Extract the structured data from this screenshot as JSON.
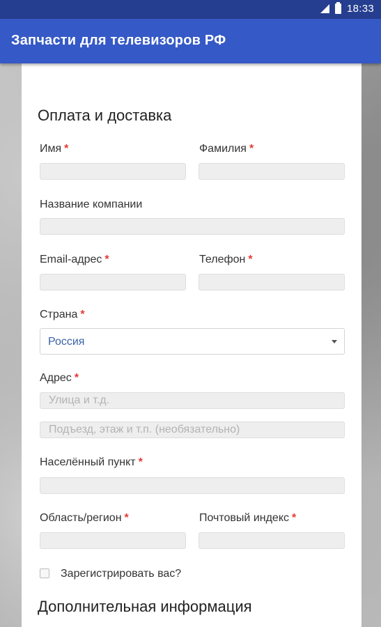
{
  "status_bar": {
    "time": "18:33"
  },
  "app_bar": {
    "title": "Запчасти для телевизоров РФ"
  },
  "form": {
    "section_title": "Оплата и доставка",
    "required_mark": "*",
    "first_name_label": "Имя",
    "last_name_label": "Фамилия",
    "company_label": "Название компании",
    "email_label": "Email-адрес",
    "phone_label": "Телефон",
    "country_label": "Страна",
    "country_value": "Россия",
    "address_label": "Адрес",
    "address1_placeholder": "Улица и т.д.",
    "address2_placeholder": "Подъезд, этаж и т.п. (необязательно)",
    "city_label": "Населённый пункт",
    "region_label": "Область/регион",
    "postcode_label": "Почтовый индекс",
    "register_label": "Зарегистрировать вас?"
  },
  "additional": {
    "section_title": "Дополнительная информация"
  }
}
